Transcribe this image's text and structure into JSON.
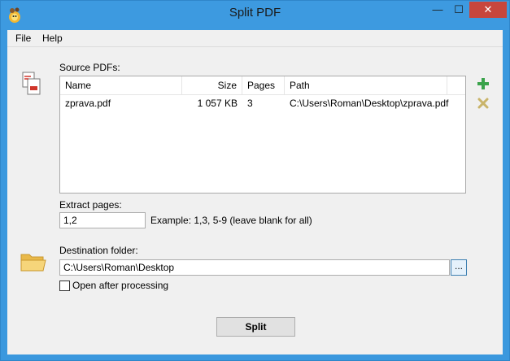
{
  "window": {
    "title": "Split PDF",
    "controls": {
      "minimize": "—",
      "maximize": "☐",
      "close": "✕"
    }
  },
  "menu": {
    "items": [
      "File",
      "Help"
    ]
  },
  "source": {
    "label": "Source PDFs:",
    "columns": [
      "Name",
      "Size",
      "Pages",
      "Path"
    ],
    "rows": [
      {
        "name": "zprava.pdf",
        "size": "1 057 KB",
        "pages": "3",
        "path": "C:\\Users\\Roman\\Desktop\\zprava.pdf"
      }
    ],
    "add_icon": "plus-icon",
    "remove_icon": "remove-icon"
  },
  "extract": {
    "label": "Extract pages:",
    "value": "1,2",
    "example": "Example: 1,3, 5-9 (leave blank for all)"
  },
  "destination": {
    "label": "Destination folder:",
    "value": "C:\\Users\\Roman\\Desktop",
    "browse_label": "...",
    "open_after_label": "Open after processing",
    "open_after_checked": false
  },
  "actions": {
    "split_label": "Split"
  },
  "colors": {
    "titlebar": "#3d9ae0",
    "close_button": "#c7463d",
    "add_icon": "#3aa34b",
    "remove_icon": "#c9b46a"
  }
}
